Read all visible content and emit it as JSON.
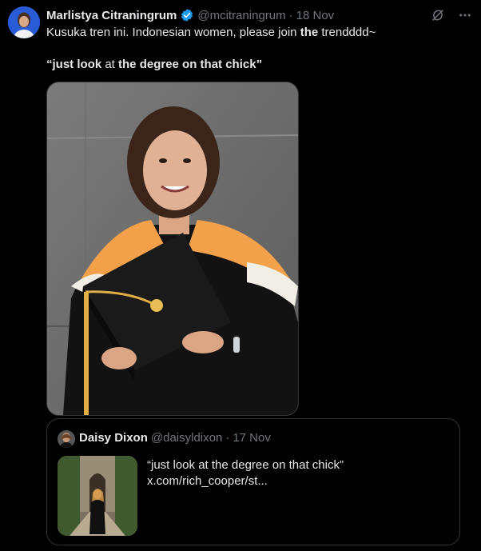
{
  "tweet": {
    "author_name": "Marlistya Citraningrum",
    "handle": "@mcitraningrum",
    "separator": "·",
    "date": "18 Nov",
    "text_line1_a": "Kusuka tren ini. Indonesian women, please join ",
    "text_line1_b": "the",
    "text_line1_c": " trendddd~",
    "text_line2_a": "“just look ",
    "text_line2_b": "at",
    "text_line2_c": " the degree on that chick”"
  },
  "quoted": {
    "author_name": "Daisy Dixon",
    "handle": "@daisyldixon",
    "separator": "·",
    "date": "17 Nov",
    "text_line1": "“just look at the degree on that chick”",
    "text_line2": "x.com/rich_cooper/st..."
  },
  "colors": {
    "background": "#000000",
    "text": "#e7e9ea",
    "muted": "#71767b",
    "border": "#2f3336",
    "verified": "#1d9bf0"
  },
  "icons": [
    "verified-badge-icon",
    "grok-icon",
    "more-icon"
  ]
}
